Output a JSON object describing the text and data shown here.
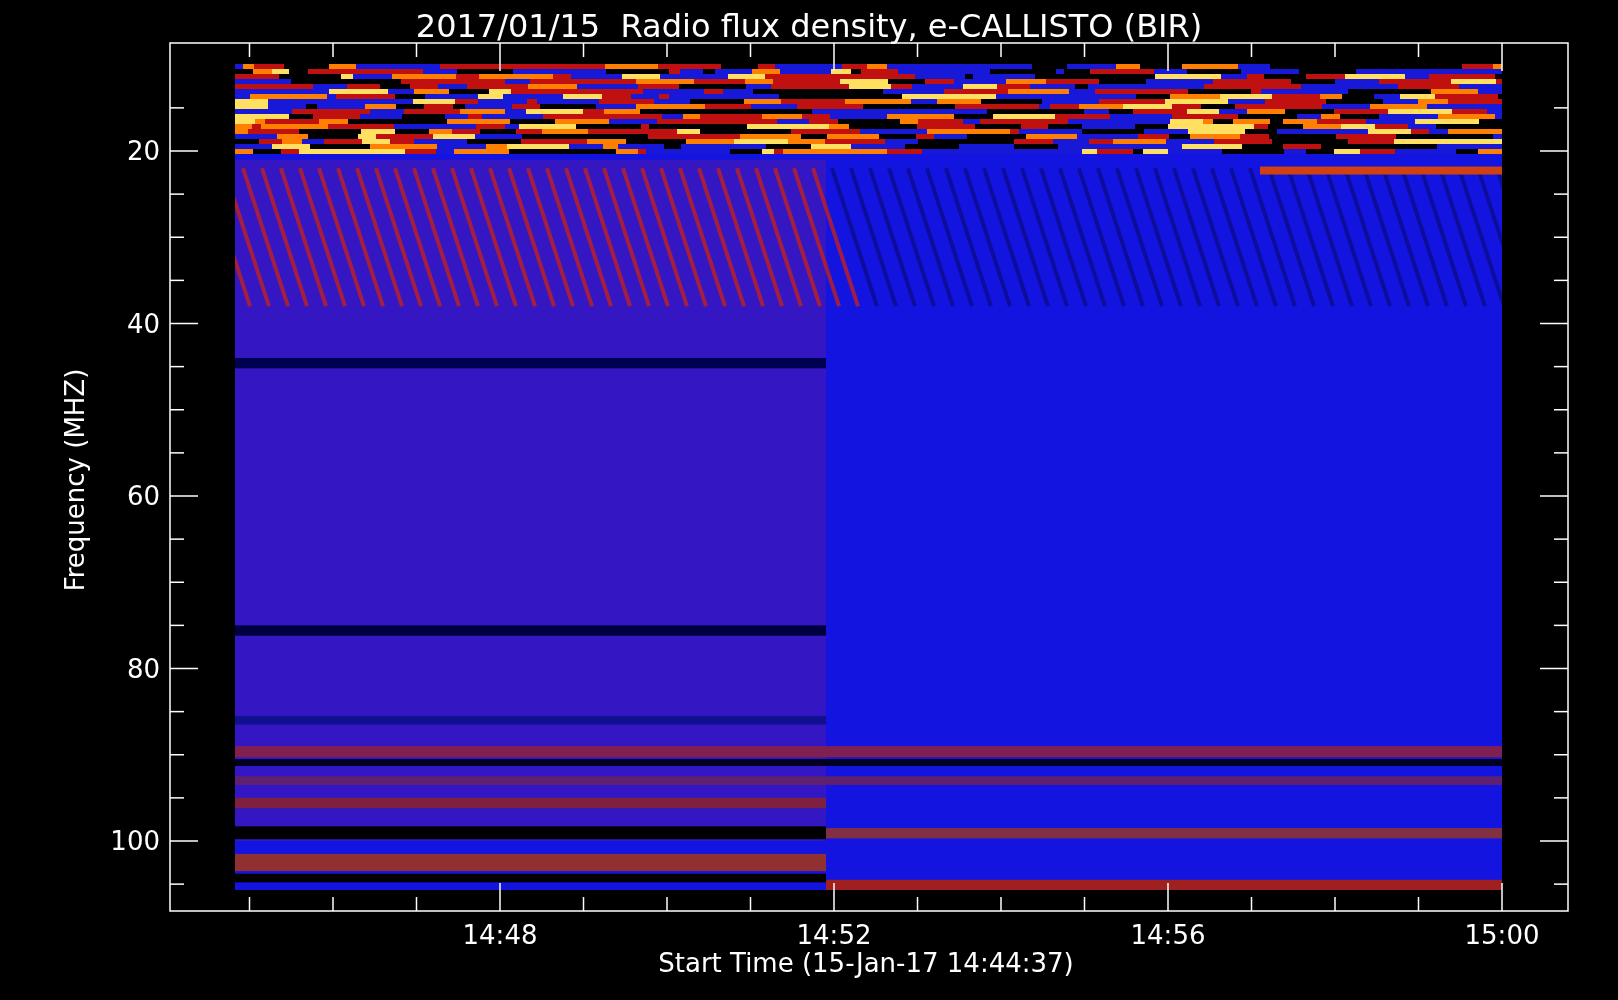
{
  "title": "2017/01/15  Radio flux density, e-CALLISTO (BIR)",
  "y_axis": {
    "label": "Frequency (MHZ)",
    "ticks": [
      "20",
      "40",
      "60",
      "80",
      "100"
    ]
  },
  "x_axis": {
    "label": "Start Time (15-Jan-17 14:44:37)",
    "ticks": [
      "14:48",
      "14:52",
      "14:56",
      "15:00"
    ]
  }
}
